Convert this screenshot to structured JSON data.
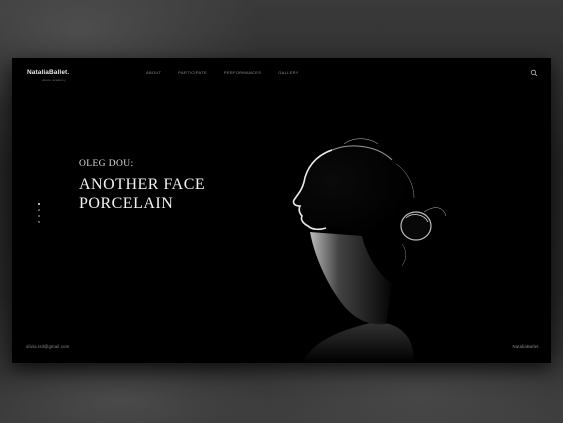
{
  "brand": {
    "logo": "NataliaBallet.",
    "tagline": "dance academy"
  },
  "nav": {
    "items": [
      {
        "label": "ABOUT"
      },
      {
        "label": "PARTICIPATE"
      },
      {
        "label": "PERFORMANCES"
      },
      {
        "label": "GALLERY"
      }
    ],
    "search_icon": "search-icon"
  },
  "hero": {
    "subtitle": "OLEG DOU:",
    "title_line1": "ANOTHER FACE",
    "title_line2": "PORCELAIN",
    "slides_count": 4,
    "active_slide": 1
  },
  "footer": {
    "email": "olivia.tsil@gmail.com",
    "brand": "NataliaBallet."
  },
  "colors": {
    "background": "#000000",
    "text_primary": "#f2f2f2",
    "text_muted": "#8e8e8e"
  }
}
